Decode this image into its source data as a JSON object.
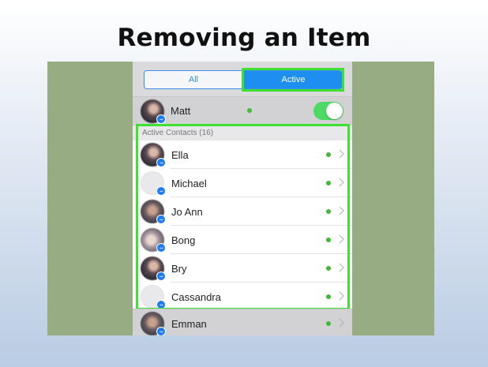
{
  "slide": {
    "title": "Removing an Item"
  },
  "segment": {
    "all_label": "All",
    "active_label": "Active"
  },
  "me": {
    "name": "Matt",
    "toggle_on": true
  },
  "section": {
    "label": "Active Contacts (16)"
  },
  "contacts": [
    {
      "name": "Ella",
      "avatar": "photo",
      "status": "online"
    },
    {
      "name": "Michael",
      "avatar": "blank",
      "status": "online"
    },
    {
      "name": "Jo Ann",
      "avatar": "photo",
      "status": "online"
    },
    {
      "name": "Bong",
      "avatar": "photo",
      "status": "online"
    },
    {
      "name": "Bry",
      "avatar": "photo",
      "status": "online"
    },
    {
      "name": "Cassandra",
      "avatar": "blank",
      "status": "online"
    }
  ],
  "after_list": {
    "name": "Emman",
    "avatar": "photo",
    "status": "online"
  },
  "colors": {
    "highlight": "#3ee032",
    "accent": "#1f8ef1",
    "online": "#3dbb35",
    "toggle": "#4cd964",
    "panel": "#97ac82"
  },
  "icons": {
    "chevron": "chevron-right-icon",
    "messenger_badge": "messenger-badge-icon",
    "online": "online-dot-icon"
  }
}
